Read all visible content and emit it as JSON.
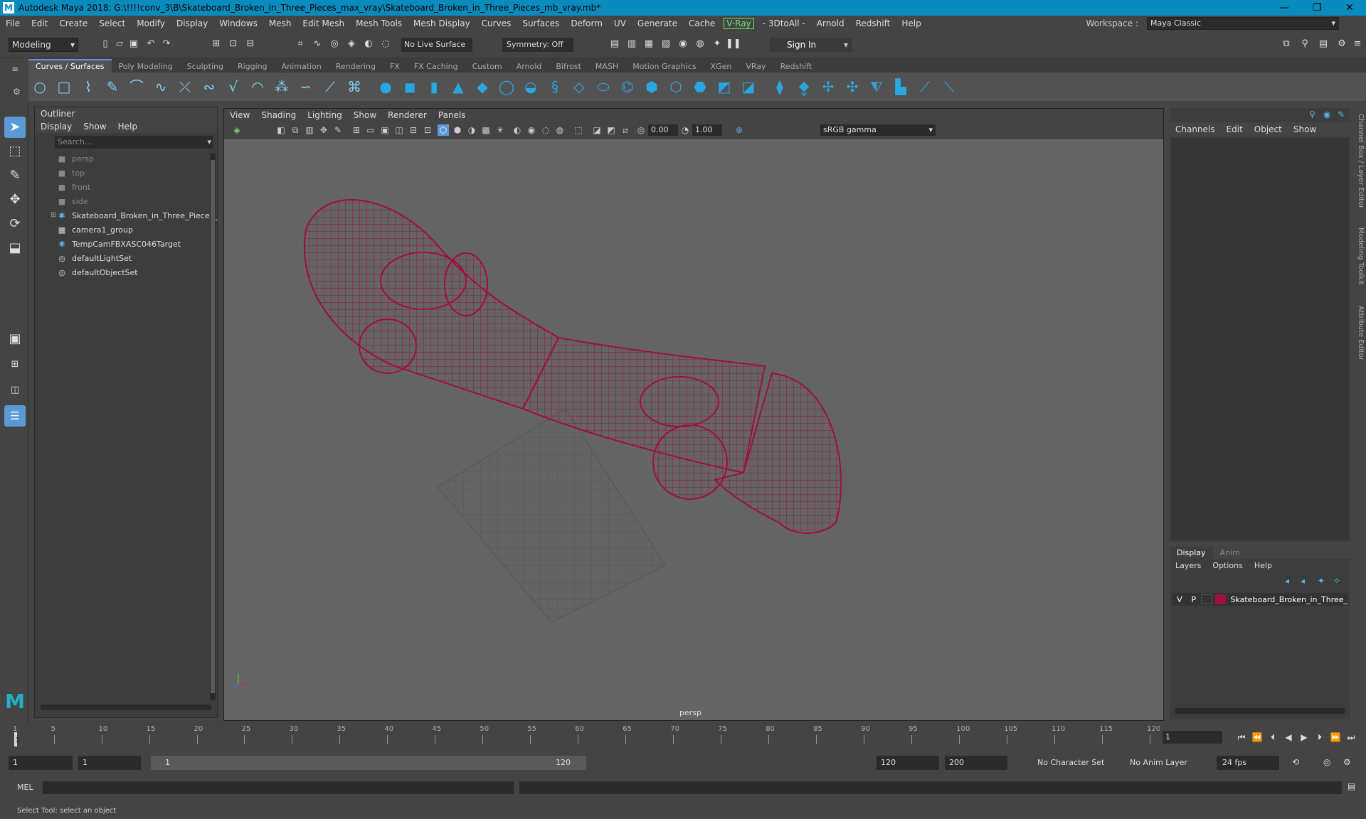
{
  "colors": {
    "accent": "#5a9bd5",
    "titlebar": "#0a8bbe",
    "wire": "#a0103c",
    "vray": "#6fe26f",
    "layer_color": "#a0103c"
  },
  "titlebar": {
    "app_icon": "maya-icon",
    "title": "Autodesk Maya 2018: G:\\!!!!conv_3\\B\\Skateboard_Broken_in_Three_Pieces_max_vray\\Skateboard_Broken_in_Three_Pieces_mb_vray.mb*",
    "minimize": "—",
    "maximize": "❐",
    "close": "✕"
  },
  "menubar": {
    "items": [
      "File",
      "Edit",
      "Create",
      "Select",
      "Modify",
      "Display",
      "Windows",
      "Mesh",
      "Edit Mesh",
      "Mesh Tools",
      "Mesh Display",
      "Curves",
      "Surfaces",
      "Deform",
      "UV",
      "Generate",
      "Cache"
    ],
    "vray": "V-Ray",
    "items2": [
      "- 3DtoAll -",
      "Arnold",
      "Redshift",
      "Help"
    ],
    "workspace_label": "Workspace :",
    "workspace_value": "Maya Classic"
  },
  "statusline": {
    "mode": "Modeling",
    "live_surface": "No Live Surface",
    "symmetry": "Symmetry: Off",
    "sign_in": "Sign In"
  },
  "shelf": {
    "tabs": [
      "Curves / Surfaces",
      "Poly Modeling",
      "Sculpting",
      "Rigging",
      "Animation",
      "Rendering",
      "FX",
      "FX Caching",
      "Custom",
      "Arnold",
      "Bifrost",
      "MASH",
      "Motion Graphics",
      "XGen",
      "VRay",
      "Redshift"
    ],
    "active": "Curves / Surfaces"
  },
  "outliner": {
    "title": "Outliner",
    "menu": [
      "Display",
      "Show",
      "Help"
    ],
    "search_placeholder": "Search...",
    "items": [
      {
        "label": "persp",
        "icon": "camera-icon",
        "dim": true
      },
      {
        "label": "top",
        "icon": "camera-icon",
        "dim": true
      },
      {
        "label": "front",
        "icon": "camera-icon",
        "dim": true
      },
      {
        "label": "side",
        "icon": "camera-icon",
        "dim": true
      },
      {
        "label": "Skateboard_Broken_in_Three_Pieces_",
        "icon": "transform-icon",
        "dim": false
      },
      {
        "label": "camera1_group",
        "icon": "group-icon",
        "dim": false
      },
      {
        "label": "TempCamFBXASC046Target",
        "icon": "transform-icon",
        "dim": false
      },
      {
        "label": "defaultLightSet",
        "icon": "set-icon",
        "dim": false
      },
      {
        "label": "defaultObjectSet",
        "icon": "set-icon",
        "dim": false
      }
    ]
  },
  "viewport": {
    "menu": [
      "View",
      "Shading",
      "Lighting",
      "Show",
      "Renderer",
      "Panels"
    ],
    "exposure": "0.00",
    "gamma": "1.00",
    "color_space": "sRGB gamma",
    "camera": "persp"
  },
  "channelbox": {
    "menu": [
      "Channels",
      "Edit",
      "Object",
      "Show"
    ],
    "side_tabs": [
      "Channel Box / Layer Editor",
      "Modeling Toolkit",
      "Attribute Editor"
    ]
  },
  "layereditor": {
    "tabs": [
      "Display",
      "Anim"
    ],
    "active": "Display",
    "menu": [
      "Layers",
      "Options",
      "Help"
    ],
    "layer": {
      "v": "V",
      "p": "P",
      "name": "Skateboard_Broken_in_Three_"
    }
  },
  "timeslider": {
    "ticks": [
      "1",
      "5",
      "10",
      "15",
      "20",
      "25",
      "30",
      "35",
      "40",
      "45",
      "50",
      "55",
      "60",
      "65",
      "70",
      "75",
      "80",
      "85",
      "90",
      "95",
      "100",
      "105",
      "110",
      "115",
      "120"
    ],
    "current_frame": "1"
  },
  "rangeslider": {
    "start": "1",
    "anim_start": "1",
    "range_start": "1",
    "range_end": "120",
    "end": "120",
    "anim_end": "200",
    "character_set": "No Character Set",
    "anim_layer": "No Anim Layer",
    "fps": "24 fps"
  },
  "cmdline": {
    "label": "MEL"
  },
  "helpline": {
    "text": "Select Tool: select an object"
  }
}
